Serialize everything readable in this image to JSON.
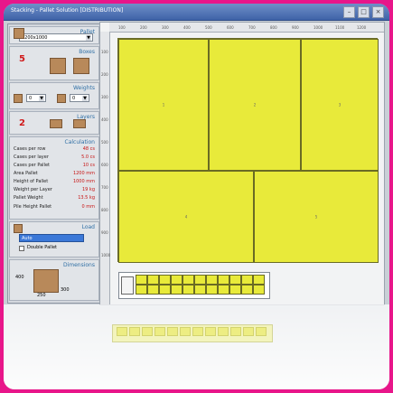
{
  "window": {
    "title": "Stacking - Pallet Solution [DISTRIBUTION]"
  },
  "panel": {
    "pallet_section": {
      "title": "Pallet",
      "select_value": "1200x1000"
    },
    "boxes_section": {
      "title": "Boxes",
      "count": "5"
    },
    "weights_section": {
      "title": "Weights",
      "field1": "0",
      "field2": "0"
    },
    "layers_section": {
      "title": "Layers",
      "count": "2"
    },
    "calc_section": {
      "title": "Calculation",
      "rows": [
        {
          "label": "Cases per row",
          "value": "48 cs"
        },
        {
          "label": "Cases per layer",
          "value": "5.0 cs"
        },
        {
          "label": "Cases per Pallet",
          "value": "10 cs"
        },
        {
          "label": "Area Pallet",
          "value": "1200 mm"
        },
        {
          "label": "Height of Pallet",
          "value": "1000 mm"
        },
        {
          "label": "Weight per Layer",
          "value": "19 kg"
        },
        {
          "label": "Pallet Weight",
          "value": "13.5 kg"
        },
        {
          "label": "Pile Height Pallet",
          "value": "0 mm"
        }
      ]
    },
    "load_section": {
      "title": "Load",
      "select_value": "Auto",
      "checkbox_label": "Double Pallet"
    },
    "dimensions_section": {
      "title": "Dimensions",
      "labels": [
        "400",
        "300",
        "250"
      ]
    }
  },
  "canvas": {
    "ruler_top": [
      "100",
      "200",
      "300",
      "400",
      "500",
      "600",
      "700",
      "800",
      "900",
      "1000",
      "1100",
      "1200"
    ],
    "ruler_left": [
      "100",
      "200",
      "300",
      "400",
      "500",
      "600",
      "700",
      "800",
      "900",
      "1000"
    ],
    "box_labels": [
      "1",
      "2",
      "3",
      "4",
      "5"
    ]
  }
}
